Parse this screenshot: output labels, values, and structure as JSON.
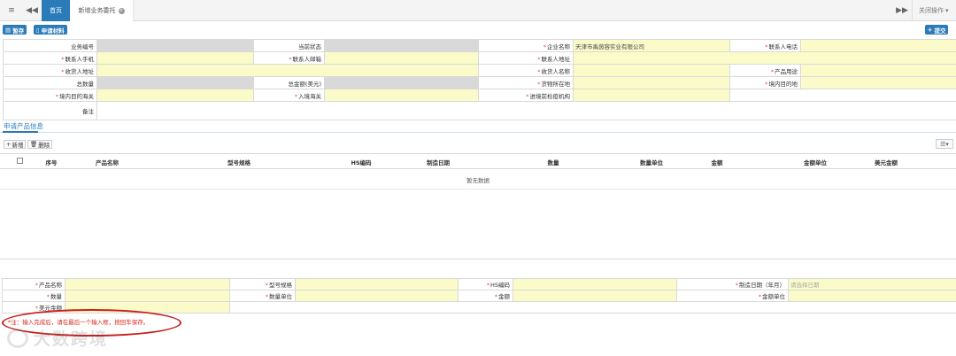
{
  "tabbar": {
    "menu_icon": "≡",
    "back_icon": "◀◀",
    "home_tab": "首页",
    "active_tab": "新增业务委托",
    "close_tab_icon": "×",
    "forward_icon": "▶▶",
    "close_ops_label": "关闭操作",
    "close_ops_caret": "▾"
  },
  "toolbar": {
    "save_label": "暂存",
    "save_icon": "▤",
    "materials_label": "申请材料",
    "materials_icon": "▯",
    "submit_label": "提交",
    "submit_icon": "✈"
  },
  "form": {
    "business_no_label": "业务编号",
    "current_status_label": "当前状态",
    "company_name_label": "企业名称",
    "company_name_value": "天津市禹茵容实业有限公司",
    "contact_phone_label": "联系人电话",
    "contact_mobile_label": "联系人手机",
    "contact_email_label": "联系人邮箱",
    "contact_address_label": "联系人地址",
    "receiver_address_label": "收货人地址",
    "receiver_name_label": "收货人名称",
    "product_use_label": "产品用途",
    "total_quantity_label": "总数量",
    "total_amount_label": "总金额(美元)",
    "goods_location_label": "货物所在地",
    "domestic_destination_label": "境内目的地",
    "domestic_customs_label": "境内目的海关",
    "entry_customs_label": "入境海关",
    "quarantine_org_label": "进境前检疫机构",
    "remark_label": "备注",
    "required_mark": "*"
  },
  "section": {
    "title": "申请产品信息",
    "add_label": "新增",
    "add_icon": "+",
    "delete_label": "删除",
    "delete_icon": "🗑",
    "columns_icon": "☰▾"
  },
  "grid": {
    "columns": [
      "序号",
      "产品名称",
      "型号规格",
      "HS编码",
      "制造日期",
      "数量",
      "数量单位",
      "金额",
      "金额单位",
      "美元金额"
    ],
    "empty_text": "暂无数据"
  },
  "detail_form": {
    "product_name_label": "产品名称",
    "model_spec_label": "型号规格",
    "hs_code_label": "HS编码",
    "manufacture_date_label": "制造日期（年月）",
    "manufacture_date_placeholder": "请选择日期",
    "quantity_label": "数量",
    "quantity_unit_label": "数量单位",
    "amount_label": "金额",
    "amount_unit_label": "金额单位",
    "usd_amount_label": "美元金额"
  },
  "note": {
    "text": "*注：输入完成后，请在最后一个输入框，按回车保存。"
  },
  "watermark": {
    "text": "大数跨境"
  }
}
